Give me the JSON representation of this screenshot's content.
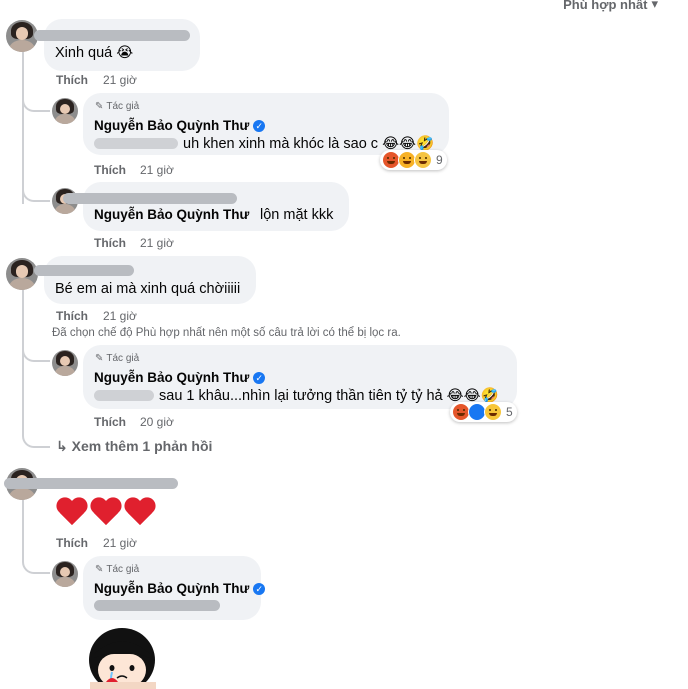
{
  "filter": {
    "label": "Phù hợp nhất",
    "icon": "caret-down-icon"
  },
  "actions": {
    "like": "Thích"
  },
  "author_badge": "Tác giả",
  "comments": [
    {
      "text": "Xinh quá 😭",
      "time": "21 giờ"
    },
    {
      "author": "Nguyễn Bảo Quỳnh Thư",
      "text": "uh khen xinh mà khóc là sao c 😂😂🤣",
      "reactions": {
        "count": "9",
        "types": [
          "angry",
          "care",
          "sad"
        ]
      },
      "time": "21 giờ"
    },
    {
      "author": "Nguyễn Bảo Quỳnh Thư",
      "text": "lộn mặt kkk",
      "time": "21 giờ"
    },
    {
      "text": "Bé em ai mà xinh quá chờiiiii",
      "time": "21 giờ"
    },
    {
      "author": "Nguyễn Bảo Quỳnh Thư",
      "text": "sau 1 khâu...nhìn lại tưởng thần tiên tỷ tỷ hả 😂😂🤣",
      "reactions": {
        "count": "5",
        "types": [
          "angry",
          "like",
          "haha"
        ]
      },
      "time": "20 giờ"
    },
    {
      "text": "",
      "time": "21 giờ",
      "content": "three-red-hearts"
    },
    {
      "author": "Nguyễn Bảo Quỳnh Thư",
      "text": "",
      "sticker": "crying-girl-sticker"
    }
  ],
  "filter_notice": "Đã chọn chế độ Phù hợp nhất nên một số câu trả lời có thể bị lọc ra.",
  "see_more": {
    "label": "Xem thêm 1 phản hồi",
    "icon": "reply-arrow-icon"
  }
}
